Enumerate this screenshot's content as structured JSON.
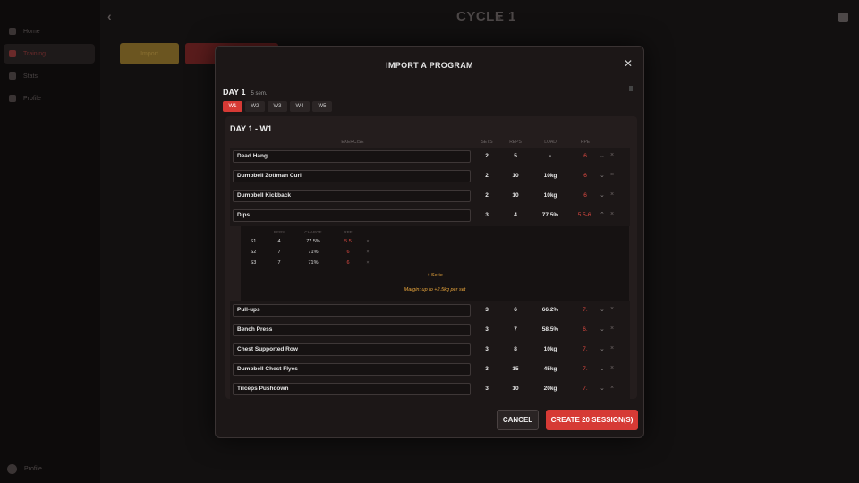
{
  "background": {
    "title": "CYCLE 1",
    "sidebar": [
      "Home",
      "Training",
      "Stats",
      "Profile"
    ],
    "user_label": "Profile",
    "gold_button": "Import"
  },
  "modal": {
    "title": "IMPORT A PROGRAM",
    "day_label": "DAY 1",
    "day_sessions": "5 sem.",
    "weeks": [
      "W1",
      "W2",
      "W3",
      "W4",
      "W5"
    ],
    "active_week": "W1",
    "panel_title": "DAY 1 - W1",
    "columns": {
      "exercise": "EXERCISE",
      "sets": "SETS",
      "reps": "REPS",
      "load": "LOAD",
      "rpe": "RPE"
    },
    "exercises": [
      {
        "name": "Dead Hang",
        "sets": "2",
        "reps": "5",
        "load": "-",
        "rpe": "6"
      },
      {
        "name": "Dumbbell Zottman Curl",
        "sets": "2",
        "reps": "10",
        "load": "10kg",
        "rpe": "6"
      },
      {
        "name": "Dumbbell Kickback",
        "sets": "2",
        "reps": "10",
        "load": "10kg",
        "rpe": "6"
      },
      {
        "name": "Dips",
        "sets": "3",
        "reps": "4",
        "load": "77.5%",
        "rpe": "5.5-6."
      },
      {
        "name": "Pull-ups",
        "sets": "3",
        "reps": "6",
        "load": "66.2%",
        "rpe": "7."
      },
      {
        "name": "Bench Press",
        "sets": "3",
        "reps": "7",
        "load": "58.5%",
        "rpe": "6."
      },
      {
        "name": "Chest Supported Row",
        "sets": "3",
        "reps": "8",
        "load": "10kg",
        "rpe": "7."
      },
      {
        "name": "Dumbbell Chest Flyes",
        "sets": "3",
        "reps": "15",
        "load": "45kg",
        "rpe": "7."
      },
      {
        "name": "Triceps Pushdown",
        "sets": "3",
        "reps": "10",
        "load": "20kg",
        "rpe": "7."
      }
    ],
    "expanded": {
      "headers": {
        "reps": "REPS",
        "charge": "CHARGE",
        "rpe": "RPE"
      },
      "sets": [
        {
          "label": "S1",
          "reps": "4",
          "charge": "77.5%",
          "rpe": "5.5"
        },
        {
          "label": "S2",
          "reps": "7",
          "charge": "71%",
          "rpe": "6"
        },
        {
          "label": "S3",
          "reps": "7",
          "charge": "71%",
          "rpe": "6"
        }
      ],
      "add_serie": "+ Serie",
      "margin_note": "Margin: up to +2.5kg per set"
    },
    "cancel_label": "CANCEL",
    "create_label": "CREATE 20 SESSION(S)",
    "colors": {
      "accent": "#d63a35",
      "gold": "#e8a53c"
    }
  }
}
